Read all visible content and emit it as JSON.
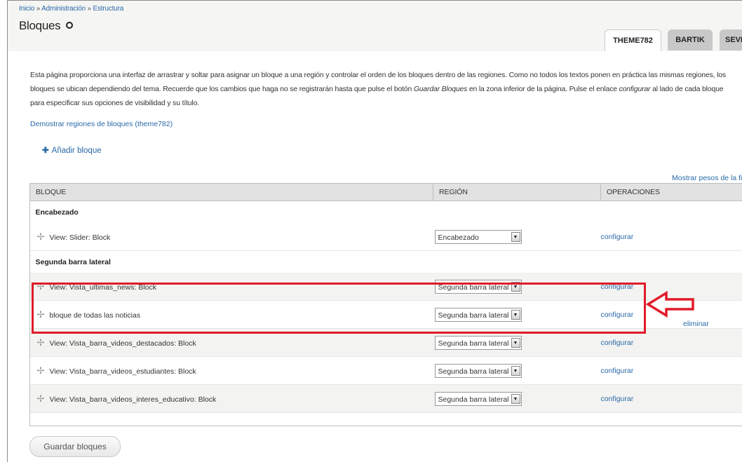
{
  "breadcrumb": {
    "items": [
      "Inicio",
      "Administración",
      "Estructura"
    ],
    "separator": "»"
  },
  "page": {
    "title": "Bloques",
    "tabs": [
      {
        "label": "THEME782",
        "active": true
      },
      {
        "label": "BARTIK",
        "active": false
      },
      {
        "label": "SEVE",
        "active": false
      }
    ]
  },
  "description": {
    "part1": "Esta página proporciona una interfaz de arrastrar y soltar para asignar un bloque a una región y controlar el orden de los bloques dentro de las regiones. Como no todos los textos ponen en práctica las mismas regiones, los bloques se ubican dependiendo del tema. Recuerde que los cambios que haga no se registrarán hasta que pulse el botón ",
    "em1": "Guardar Bloques",
    "part2": " en la zona inferior de la página. Pulse el enlace ",
    "em2": "configurar",
    "part3": " al lado de cada bloque para especificar sus opciones de visibilidad y su título."
  },
  "links": {
    "demo": "Demostrar regiones de bloques (theme782)",
    "add_block": "Añadir bloque",
    "show_weights": "Mostrar pesos de la fil"
  },
  "table": {
    "headers": {
      "block": "BLOQUE",
      "region": "REGIÓN",
      "operations": "OPERACIONES"
    },
    "regions": [
      {
        "name": "Encabezado",
        "rows": [
          {
            "block": "View: Slider: Block",
            "region": "Encabezado",
            "op": "configurar"
          }
        ]
      },
      {
        "name": "Segunda barra lateral",
        "rows": [
          {
            "block": "View: Vista_ultimas_news: Block",
            "region": "Segunda barra lateral",
            "op": "configurar"
          },
          {
            "block": "bloque de todas las noticias",
            "region": "Segunda barra lateral",
            "op": "configurar"
          },
          {
            "block": "View: Vista_barra_videos_destacados: Block",
            "region": "Segunda barra lateral",
            "op": "configurar"
          },
          {
            "block": "View: Vista_barra_videos_estudiantes: Block",
            "region": "Segunda barra lateral",
            "op": "configurar"
          },
          {
            "block": "View: Vista_barra_videos_interes_educativo: Block",
            "region": "Segunda barra lateral",
            "op": "configurar"
          }
        ]
      }
    ],
    "extra_delete": "eliminar"
  },
  "buttons": {
    "save": "Guardar bloques"
  },
  "colors": {
    "link": "#2a6aa8",
    "highlight": "#e01b2a"
  }
}
